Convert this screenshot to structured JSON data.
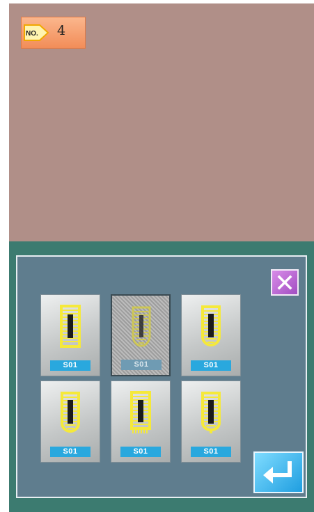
{
  "pattern_number": {
    "icon": "no-tag-icon",
    "icon_label": "NO.",
    "value": "4"
  },
  "selector": {
    "close_icon": "close-icon",
    "enter_icon": "enter-return-icon",
    "tiles": [
      {
        "label": "S01",
        "icon": "stitch-pattern-rect-icon",
        "selected": false
      },
      {
        "label": "S01",
        "icon": "stitch-pattern-round-bottom-icon",
        "selected": true
      },
      {
        "label": "S01",
        "icon": "stitch-pattern-u-shape-icon",
        "selected": false
      },
      {
        "label": "S01",
        "icon": "stitch-pattern-u-shape-icon",
        "selected": false
      },
      {
        "label": "S01",
        "icon": "stitch-pattern-bartack-icon",
        "selected": false
      },
      {
        "label": "S01",
        "icon": "stitch-pattern-keyhole-icon",
        "selected": false
      }
    ]
  },
  "colors": {
    "top_background": "#b08f88",
    "bottom_background": "#3c7b70",
    "panel_background": "#5f7d8e",
    "pattern_stitch": "#f5e93a",
    "label_background": "#29a8de"
  }
}
